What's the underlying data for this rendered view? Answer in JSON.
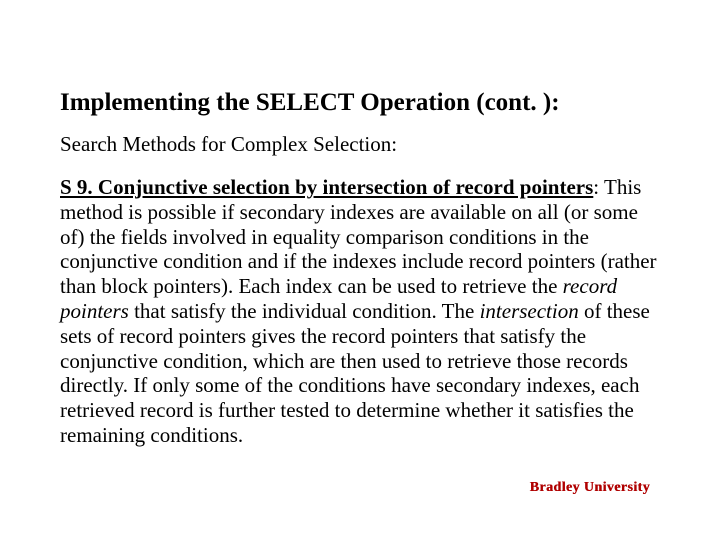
{
  "title": "Implementing the SELECT Operation (cont. ):",
  "subtitle": "Search Methods for Complex Selection:",
  "body": {
    "lead": "S 9. Conjunctive selection by intersection of record pointers",
    "p1": ": This method is possible if secondary indexes are available on all (or some of) the fields involved in equality comparison conditions in the conjunctive condition and if the indexes include record pointers (rather than block pointers). Each index can be used to retrieve the ",
    "i1": "record pointers",
    "p2": " that satisfy the individual condition. The ",
    "i2": "intersection",
    "p3": " of these sets of record pointers gives the record pointers that satisfy the conjunctive condition, which are then used to retrieve those records directly. If only some of the conditions have secondary indexes, each retrieved record is further tested to determine whether it satisfies the remaining conditions."
  },
  "footer": "Bradley University"
}
